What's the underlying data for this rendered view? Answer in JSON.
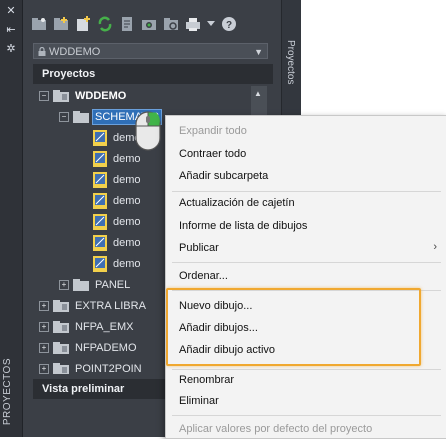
{
  "palette": {
    "title": "PROYECTOS",
    "side_label": "Proyectos",
    "project_selector": "WDDEMO",
    "panel_header": "Proyectos",
    "preview_header": "Vista preliminar"
  },
  "toolbar_icons": [
    "open-project-icon",
    "new-project-icon",
    "new-drawing-icon",
    "refresh-icon",
    "tasks-icon",
    "scan-icon",
    "project-settings-icon",
    "plot-icon",
    "help-icon"
  ],
  "tree": {
    "root": "WDDEMO",
    "folder": "SCHEMATIC",
    "drawings": [
      "demo",
      "demo",
      "demo",
      "demo",
      "demo",
      "demo",
      "demo"
    ],
    "panel": "PANEL",
    "others": [
      "EXTRA LIBRA",
      "NFPA_EMX",
      "NFPADEMO",
      "POINT2POIN"
    ]
  },
  "context_menu": {
    "expand_all": "Expandir todo",
    "collapse_all": "Contraer todo",
    "add_subfolder": "Añadir subcarpeta",
    "title_block_update": "Actualización de cajetín",
    "drawing_list_report": "Informe de lista de dibujos",
    "publish": "Publicar",
    "sort": "Ordenar...",
    "new_drawing": "Nuevo dibujo...",
    "add_drawings": "Añadir dibujos...",
    "add_active_drawing": "Añadir dibujo activo",
    "rename": "Renombrar",
    "delete": "Eliminar",
    "apply_defaults": "Aplicar valores por defecto del proyecto"
  }
}
